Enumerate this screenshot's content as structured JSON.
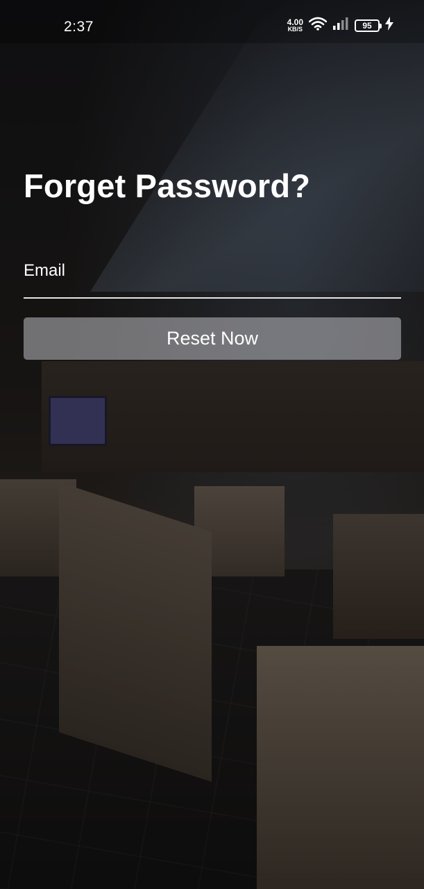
{
  "status_bar": {
    "time": "2:37",
    "net_speed_value": "4.00",
    "net_speed_unit": "KB/S",
    "battery_level": "95",
    "icons": [
      "wifi-icon",
      "signal-icon",
      "battery-icon",
      "charging-bolt-icon"
    ]
  },
  "page": {
    "title": "Forget Password?"
  },
  "form": {
    "email_label": "Email",
    "email_value": "",
    "reset_label": "Reset Now"
  },
  "colors": {
    "text": "#ffffff",
    "button_bg": "#bebec3",
    "underline": "#e6e6e6"
  }
}
